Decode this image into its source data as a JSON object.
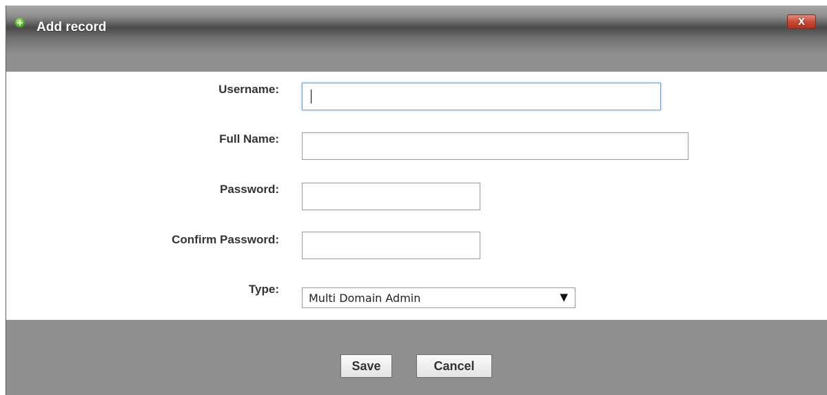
{
  "dialog": {
    "title": "Add record",
    "title_icon": "add-circle-icon",
    "close_label": "X"
  },
  "form": {
    "username": {
      "label": "Username:",
      "value": ""
    },
    "full_name": {
      "label": "Full Name:",
      "value": ""
    },
    "password": {
      "label": "Password:",
      "value": ""
    },
    "confirm_password": {
      "label": "Confirm Password:",
      "value": ""
    },
    "type": {
      "label": "Type:",
      "selected": "Multi Domain Admin",
      "arrow": "▼"
    }
  },
  "buttons": {
    "save": "Save",
    "cancel": "Cancel"
  },
  "colors": {
    "dialog_body": "#8f8f8f",
    "form_background": "#ffffff",
    "close_button": "#c94a37",
    "focus_border": "#7da2ce"
  }
}
